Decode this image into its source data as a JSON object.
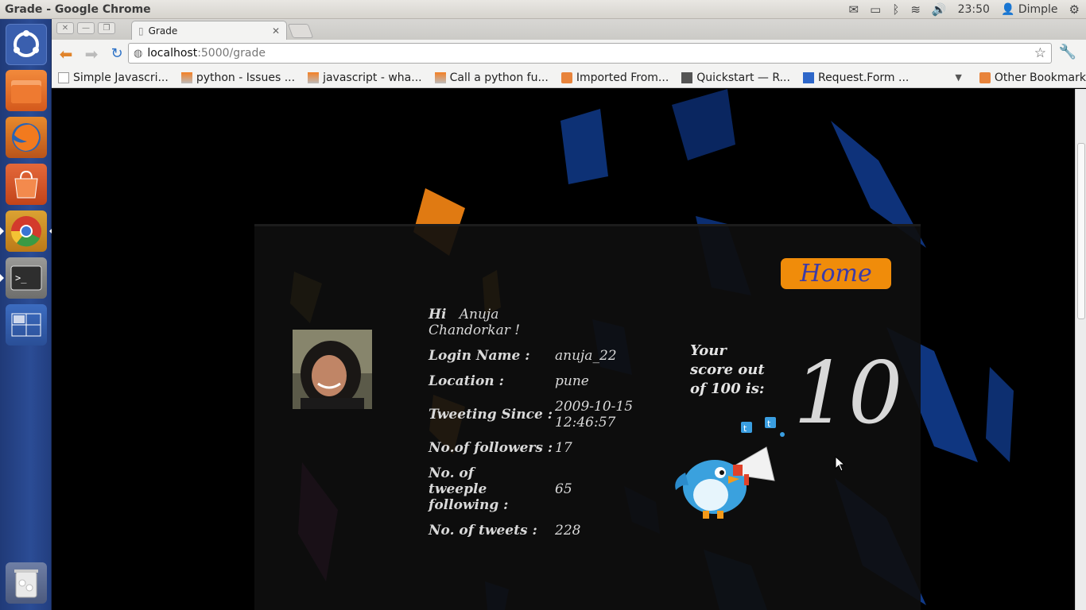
{
  "os": {
    "window_title": "Grade - Google Chrome",
    "clock": "23:50",
    "user": "Dimple"
  },
  "browser": {
    "tab_title": "Grade",
    "url_host": "localhost",
    "url_rest": ":5000/grade",
    "bookmarks": [
      "Simple Javascri...",
      "python - Issues ...",
      "javascript - wha...",
      "Call a python fu...",
      "Imported From...",
      "Quickstart — R...",
      "Request.Form ..."
    ],
    "other_bookmarks": "Other Bookmarks"
  },
  "page": {
    "home_label": "Home",
    "greeting_hi": "Hi",
    "greeting_name": "Anuja Chandorkar !",
    "rows": [
      {
        "label": "Login Name :",
        "value": "anuja_22"
      },
      {
        "label": "Location :",
        "value": "pune"
      },
      {
        "label": "Tweeting Since :",
        "value": "2009-10-15 12:46:57"
      },
      {
        "label": "No.of followers :",
        "value": "17"
      },
      {
        "label": "No. of tweeple following :",
        "value": "65"
      },
      {
        "label": "No. of tweets :",
        "value": "228"
      }
    ],
    "score_label": "Your score out of 100 is:",
    "score": "10"
  },
  "colors": {
    "home_button": "#f08c0a",
    "home_text": "#3c3ba8",
    "launcher": "#2b4c95"
  }
}
